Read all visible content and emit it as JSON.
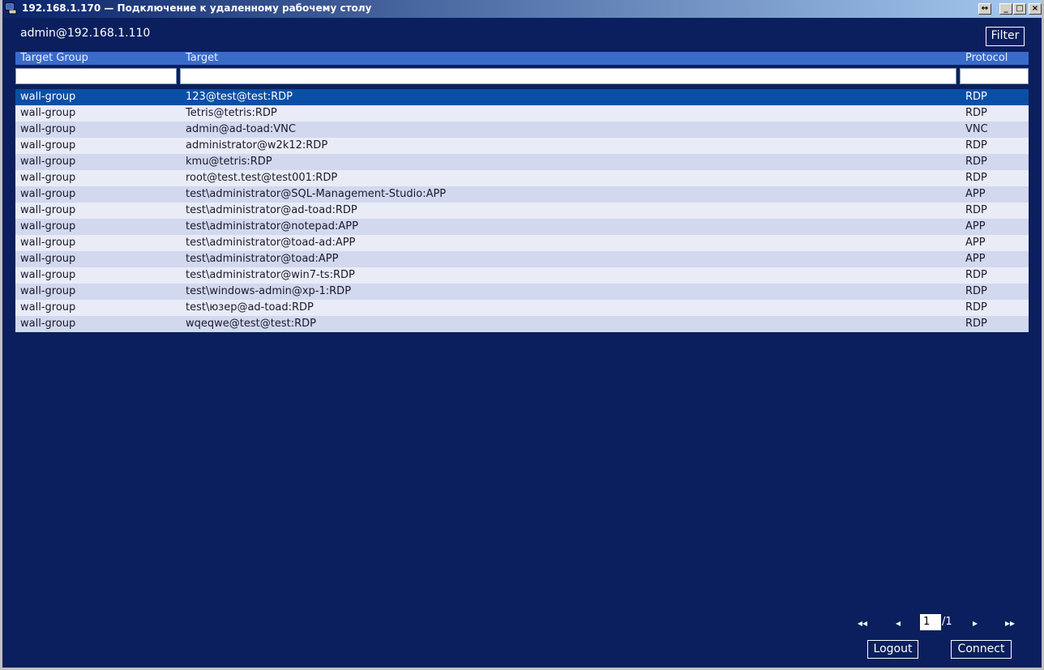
{
  "window": {
    "title": "192.168.1.170 — Подключение к удаленному рабочему столу",
    "buttons": {
      "restore_symbol": "↔",
      "minimize_symbol": "_",
      "maximize_symbol": "□",
      "close_symbol": "×"
    }
  },
  "header": {
    "user": "admin@192.168.1.110",
    "filter_label": "Filter"
  },
  "table": {
    "columns": [
      "Target Group",
      "Target",
      "Protocol"
    ],
    "rows": [
      {
        "group": "wall-group",
        "target": "123@test@test:RDP",
        "protocol": "RDP",
        "selected": true
      },
      {
        "group": "wall-group",
        "target": "Tetris@tetris:RDP",
        "protocol": "RDP"
      },
      {
        "group": "wall-group",
        "target": "admin@ad-toad:VNC",
        "protocol": "VNC"
      },
      {
        "group": "wall-group",
        "target": "administrator@w2k12:RDP",
        "protocol": "RDP"
      },
      {
        "group": "wall-group",
        "target": "kmu@tetris:RDP",
        "protocol": "RDP"
      },
      {
        "group": "wall-group",
        "target": "root@test.test@test001:RDP",
        "protocol": "RDP"
      },
      {
        "group": "wall-group",
        "target": "test\\administrator@SQL-Management-Studio:APP",
        "protocol": "APP"
      },
      {
        "group": "wall-group",
        "target": "test\\administrator@ad-toad:RDP",
        "protocol": "RDP"
      },
      {
        "group": "wall-group",
        "target": "test\\administrator@notepad:APP",
        "protocol": "APP"
      },
      {
        "group": "wall-group",
        "target": "test\\administrator@toad-ad:APP",
        "protocol": "APP"
      },
      {
        "group": "wall-group",
        "target": "test\\administrator@toad:APP",
        "protocol": "APP"
      },
      {
        "group": "wall-group",
        "target": "test\\administrator@win7-ts:RDP",
        "protocol": "RDP"
      },
      {
        "group": "wall-group",
        "target": "test\\windows-admin@xp-1:RDP",
        "protocol": "RDP"
      },
      {
        "group": "wall-group",
        "target": "test\\юзер@ad-toad:RDP",
        "protocol": "RDP"
      },
      {
        "group": "wall-group",
        "target": "wqeqwe@test@test:RDP",
        "protocol": "RDP"
      }
    ]
  },
  "pager": {
    "first_symbol": "◂◂",
    "prev_symbol": "◂",
    "next_symbol": "▸",
    "last_symbol": "▸▸",
    "current_page": "1",
    "total_pages": "/1"
  },
  "actions": {
    "logout_label": "Logout",
    "connect_label": "Connect"
  }
}
